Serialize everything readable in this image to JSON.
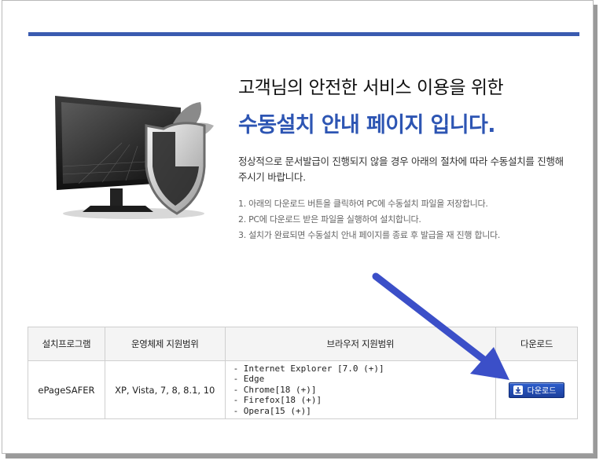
{
  "headline": {
    "line1": "고객님의 안전한 서비스 이용을 위한",
    "line2": "수동설치 안내 페이지 입니다."
  },
  "intro": "정상적으로 문서발급이 진행되지 않을 경우 아래의 절차에 따라 수동설치를 진행해 주시기 바랍니다.",
  "steps": [
    "1. 아래의 다운로드 버튼을 클릭하여 PC에 수동설치 파일을 저장합니다.",
    "2. PC에 다운로드 받은 파일을 실행하여 설치합니다.",
    "3. 설치가 완료되면 수동설치 안내 페이지를 종료 후 발급을 재 진행 합니다."
  ],
  "table": {
    "headers": [
      "설치프로그램",
      "운영체제 지원범위",
      "브라우저 지원범위",
      "다운로드"
    ],
    "rows": [
      {
        "program": "ePageSAFER",
        "os": "XP, Vista, 7, 8, 8.1, 10",
        "browsers": [
          "- Internet Explorer [7.0 (+)]",
          "- Edge",
          "- Chrome[18 (+)]",
          "- Firefox[18 (+)]",
          "- Opera[15 (+)]"
        ],
        "download_label": "다운로드"
      }
    ]
  },
  "icons": {
    "hero": "monitor-shield-icon",
    "download": "download-icon",
    "annotation": "arrow-pointer"
  },
  "colors": {
    "accent": "#3a5bb0",
    "headline_blue": "#2d55b3",
    "arrow": "#3b4fc8"
  }
}
